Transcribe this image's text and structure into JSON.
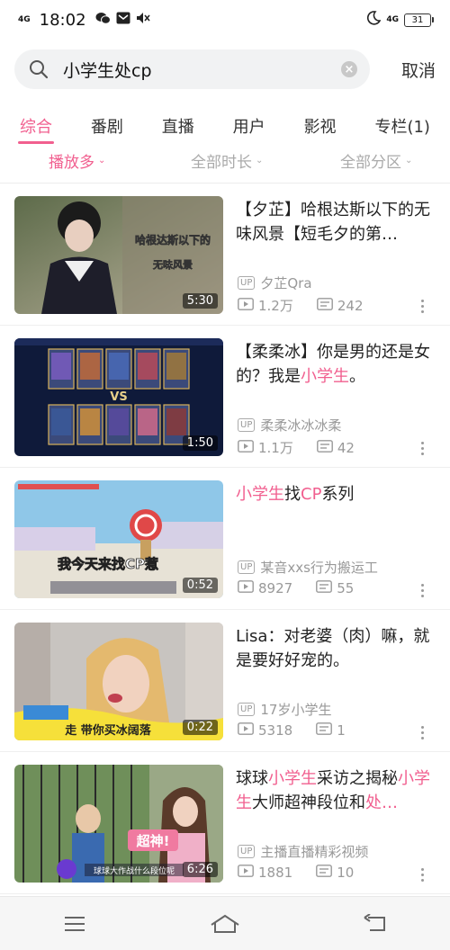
{
  "status_bar": {
    "network_left": "4G",
    "time": "18:02",
    "network_right": "4G",
    "battery": "31",
    "icons": [
      "wechat-icon",
      "message-icon",
      "mute-icon",
      "moon-icon"
    ]
  },
  "search": {
    "query": "小学生处cp",
    "cancel_label": "取消"
  },
  "tabs": [
    {
      "label": "综合",
      "active": true
    },
    {
      "label": "番剧",
      "active": false
    },
    {
      "label": "直播",
      "active": false
    },
    {
      "label": "用户",
      "active": false
    },
    {
      "label": "影视",
      "active": false
    },
    {
      "label": "专栏(1)",
      "active": false
    }
  ],
  "filters": [
    {
      "label": "播放多",
      "active": true
    },
    {
      "label": "全部时长",
      "active": false
    },
    {
      "label": "全部分区",
      "active": false
    }
  ],
  "results": [
    {
      "title_parts": [
        {
          "text": "【夕芷】哈根达斯以下的无味风景【短毛夕的第…",
          "hl": false
        }
      ],
      "uploader": "夕芷Qra",
      "views": "1.2万",
      "danmaku": "242",
      "duration": "5:30",
      "thumb_caption": [
        "哈根达斯以下的",
        "无味风景"
      ]
    },
    {
      "title_parts": [
        {
          "text": "【柔柔冰】你是男的还是女的？我是",
          "hl": false
        },
        {
          "text": "小学生",
          "hl": true
        },
        {
          "text": "。",
          "hl": false
        }
      ],
      "uploader": "柔柔冰冰冰柔",
      "views": "1.1万",
      "danmaku": "42",
      "duration": "1:50",
      "thumb_caption": [
        "VS"
      ]
    },
    {
      "title_parts": [
        {
          "text": "小学生",
          "hl": true
        },
        {
          "text": "找",
          "hl": false
        },
        {
          "text": "CP",
          "hl": true
        },
        {
          "text": "系列",
          "hl": false
        }
      ],
      "uploader": "某音xxs行为搬运工",
      "views": "8927",
      "danmaku": "55",
      "duration": "0:52",
      "thumb_caption": [
        "我今天来找CP惹"
      ]
    },
    {
      "title_parts": [
        {
          "text": "Lisa：对老婆（肉）嘛，就是要好好宠的。",
          "hl": false
        }
      ],
      "uploader": "17岁小学生",
      "views": "5318",
      "danmaku": "1",
      "duration": "0:22",
      "thumb_caption": [
        "走 带你买冰阔落"
      ]
    },
    {
      "title_parts": [
        {
          "text": "球球",
          "hl": false
        },
        {
          "text": "小学生",
          "hl": true
        },
        {
          "text": "采访之揭秘",
          "hl": false
        },
        {
          "text": "小学生",
          "hl": true
        },
        {
          "text": "大师超神段位和",
          "hl": false
        },
        {
          "text": "处…",
          "hl": true
        }
      ],
      "uploader": "主播直播精彩视频",
      "views": "1881",
      "danmaku": "10",
      "duration": "6:26",
      "thumb_caption": [
        "超神!",
        "球球大作战什么段位呢"
      ]
    }
  ],
  "navbar": {
    "buttons": [
      "menu-icon",
      "home-icon",
      "back-icon"
    ]
  },
  "colors": {
    "accent": "#f15f8f",
    "muted": "#999999",
    "search_bg": "#f1f2f3"
  }
}
